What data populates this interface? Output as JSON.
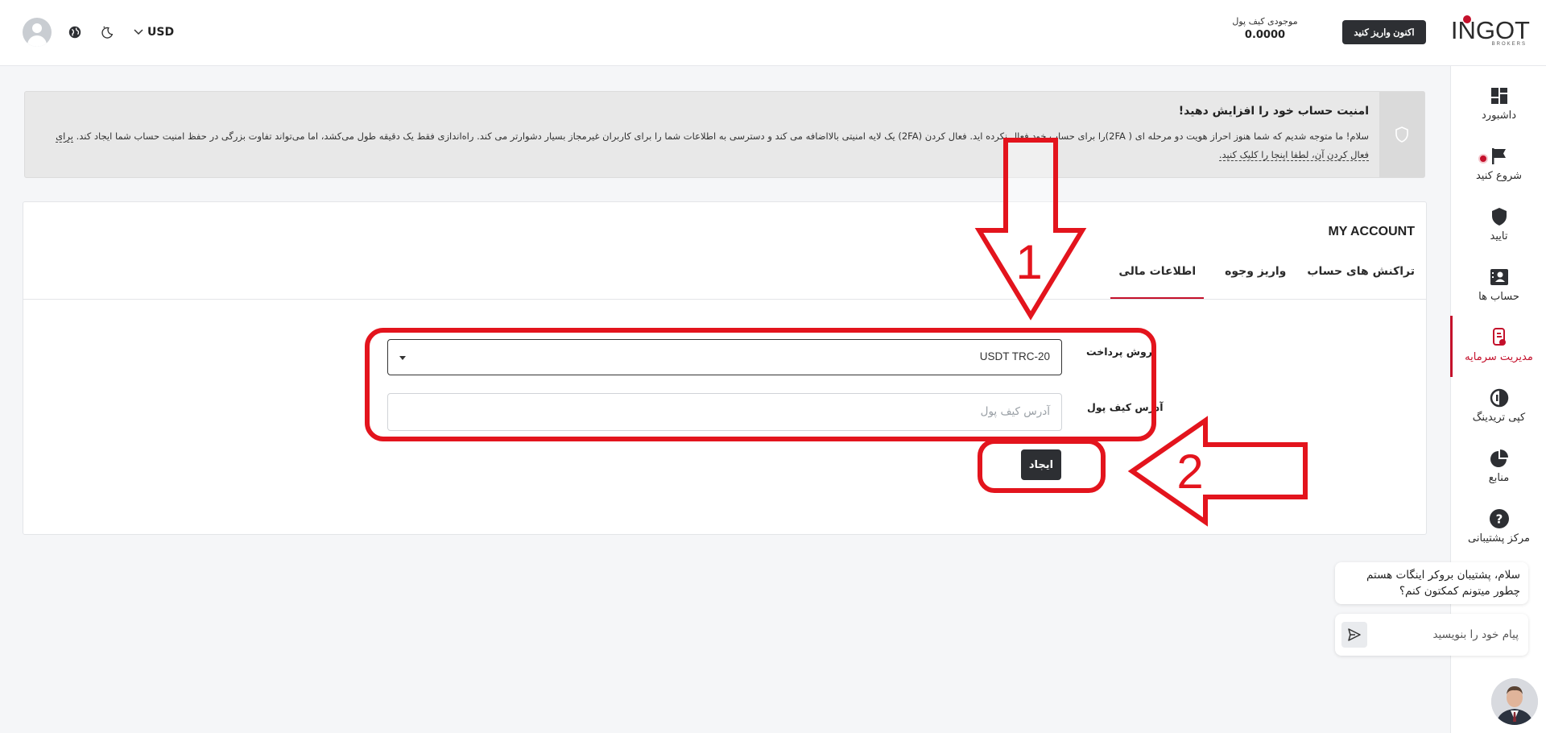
{
  "header": {
    "logo_text": "INGOT",
    "logo_subtext": "BROKERS",
    "deposit_label": "اکنون واریز کنید",
    "wallet_label": "موجودی کیف پول",
    "wallet_value": "0.0000",
    "currency": "USD"
  },
  "sidebar": {
    "items": [
      {
        "label": "داشبورد",
        "icon": "dashboard-icon"
      },
      {
        "label": "شروع کنید",
        "icon": "flag-icon"
      },
      {
        "label": "تایید",
        "icon": "shield-icon"
      },
      {
        "label": "حساب ها",
        "icon": "accounts-icon"
      },
      {
        "label": "مدیریت سرمایه",
        "icon": "funds-icon"
      },
      {
        "label": "کپی تریدینگ",
        "icon": "copy-trading-icon"
      },
      {
        "label": "منابع",
        "icon": "pie-chart-icon"
      },
      {
        "label": "مرکز پشتیبانی",
        "icon": "help-icon"
      }
    ],
    "active_index": 4,
    "accent_color": "#c4102b"
  },
  "alert": {
    "title": "امنیت حساب خود را افزایش دهید!",
    "body_line1": "سلام! ما متوجه شدیم که شما هنوز احراز هویت دو مرحله ای ( 2FA)را برای حساب خود فعال نکرده اید. فعال کردن (2FA) یک لایه امنیتی بالااضافه می کند و دسترسی به اطلاعات شما را برای کاربران غیرمجاز بسیار دشوارتر می کند. راه‌اندازی فقط یک دقیقه طول می‌کشد، اما می‌تواند تفاوت بزرگی در حفظ امنیت حساب",
    "body_line2": "شما ایجاد کند. ",
    "link": "برای فعال کردن آن، لطفا اینجا را کلیک کنید."
  },
  "account": {
    "title": "MY ACCOUNT",
    "tabs": [
      {
        "label": "تراکنش های حساب"
      },
      {
        "label": "واریز وجوه"
      },
      {
        "label": "اطلاعات مالی"
      }
    ],
    "active_tab": 2,
    "payment_method_label": "روش پرداخت",
    "payment_method_value": "USDT TRC-20",
    "wallet_address_label": "آدرس کیف پول",
    "wallet_address_placeholder": "آدرس کیف پول",
    "create_label": "ایجاد"
  },
  "annotations": {
    "step1": "1",
    "step2": "2",
    "color": "#e3141d"
  },
  "chat": {
    "message": "سلام، پشتیبان بروکر اینگات هستم چطور میتونم کمکتون کنم؟",
    "input_placeholder": "پیام خود را بنویسید"
  }
}
